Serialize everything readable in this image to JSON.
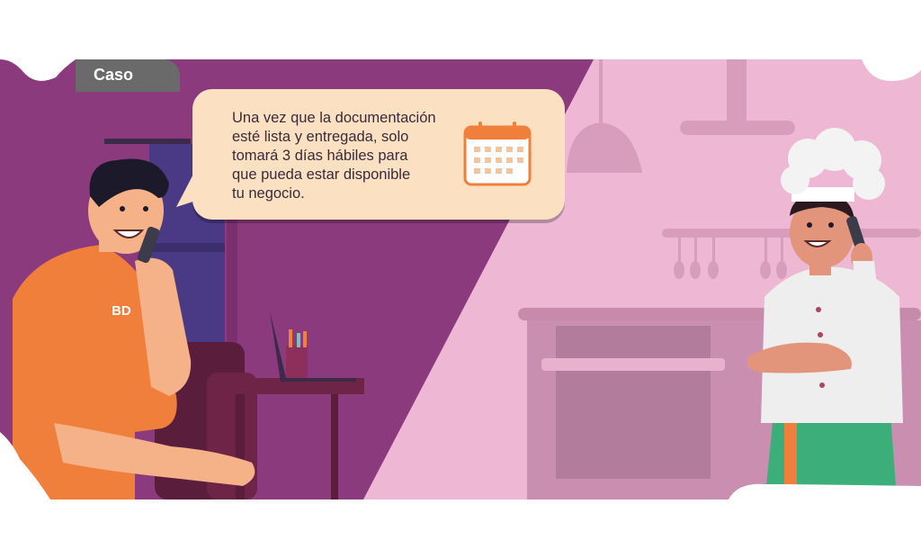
{
  "case_tab": {
    "label": "Caso"
  },
  "bubble": {
    "message": "Una vez que la documentación\nesté lista y entregada, solo\ntomará 3 días hábiles para\nque pueda estar disponible\ntu negocio."
  },
  "shirt_logo": "BD",
  "icons": [
    "calendar-icon"
  ],
  "colors": {
    "left_bg": "#8b3a7e",
    "right_bg": "#eeb8d4",
    "bubble": "#fbe1c2",
    "accent_orange": "#f07f3c",
    "tab": "#6a6a6a"
  }
}
